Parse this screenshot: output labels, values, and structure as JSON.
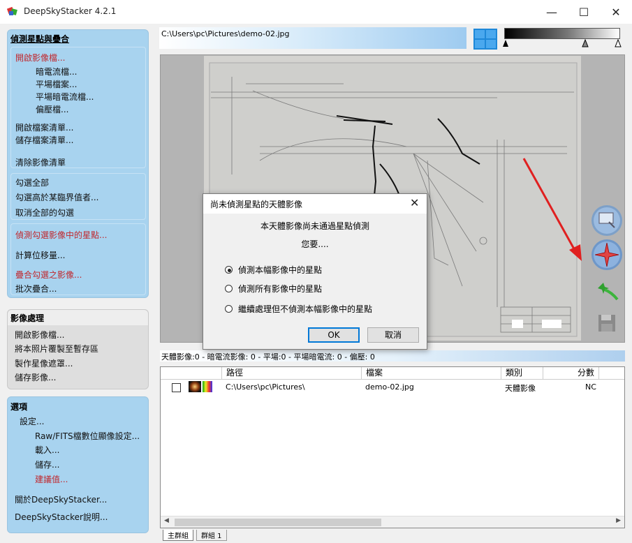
{
  "window": {
    "title": "DeepSkyStacker 4.2.1",
    "minimize": "—",
    "maximize": "☐",
    "close": "✕"
  },
  "panel1": {
    "title": "偵測星點與疊合",
    "open_images": "開啟影像檔...",
    "dark_files": "暗電流檔...",
    "flat_files": "平場檔案...",
    "dark_flat_files": "平場暗電流檔...",
    "offset_files": "偏壓檔...",
    "open_file_list": "開啟檔案清單...",
    "save_file_list": "儲存檔案清單...",
    "clear_list": "清除影像清單",
    "check_all": "勾選全部",
    "check_above": "勾選高於某臨界值者...",
    "uncheck_all": "取消全部的勾選",
    "register_checked": "偵測勾選影像中的星點...",
    "compute_offsets": "計算位移量...",
    "stack_checked": "疊合勾選之影像...",
    "batch_stacking": "批次疊合..."
  },
  "panel2": {
    "title": "影像處理",
    "open_image": "開啟影像檔...",
    "copy_to_clipboard": "將本照片覆製至暫存區",
    "create_starmask": "製作星像遮罩...",
    "save_image": "儲存影像..."
  },
  "panel3": {
    "title": "選項",
    "settings": "設定...",
    "raw_fits": "Raw/FITS檔數位顯像設定...",
    "load": "載入...",
    "save": "儲存...",
    "recommended": "建議值...",
    "about": "關於DeepSkyStacker...",
    "help": "DeepSkyStacker說明..."
  },
  "path": "C:\\Users\\pc\\Pictures\\demo-02.jpg",
  "status": {
    "text": "天體影像:0    -    暗電流影像: 0    -    平場:0    -    平場暗電流: 0    -    偏壓: 0"
  },
  "list": {
    "headers": [
      "",
      "路徑",
      "檔案",
      "類別",
      "分數"
    ],
    "rows": [
      {
        "path": "C:\\Users\\pc\\Pictures\\",
        "file": "demo-02.jpg",
        "type": "天體影像",
        "score": "NC",
        "checked": false
      }
    ]
  },
  "tabs": [
    "主群組",
    "群組 1"
  ],
  "dialog": {
    "title": "尚未偵測星點的天體影像",
    "message1": "本天體影像尚未通過星點偵測",
    "message2": "您要....",
    "options": [
      {
        "label": "偵測本幅影像中的星點",
        "selected": true
      },
      {
        "label": "偵測所有影像中的星點",
        "selected": false
      },
      {
        "label": "繼續處理但不偵測本幅影像中的星點",
        "selected": false
      }
    ],
    "ok": "OK",
    "cancel": "取消"
  },
  "tools": [
    "zoom-select-icon",
    "star-edit-icon",
    "comet-edit-icon",
    "save-icon"
  ],
  "colors": {
    "panel_blue": "#a8d3ef",
    "link_red": "#c0272d",
    "accent": "#0078d7"
  }
}
